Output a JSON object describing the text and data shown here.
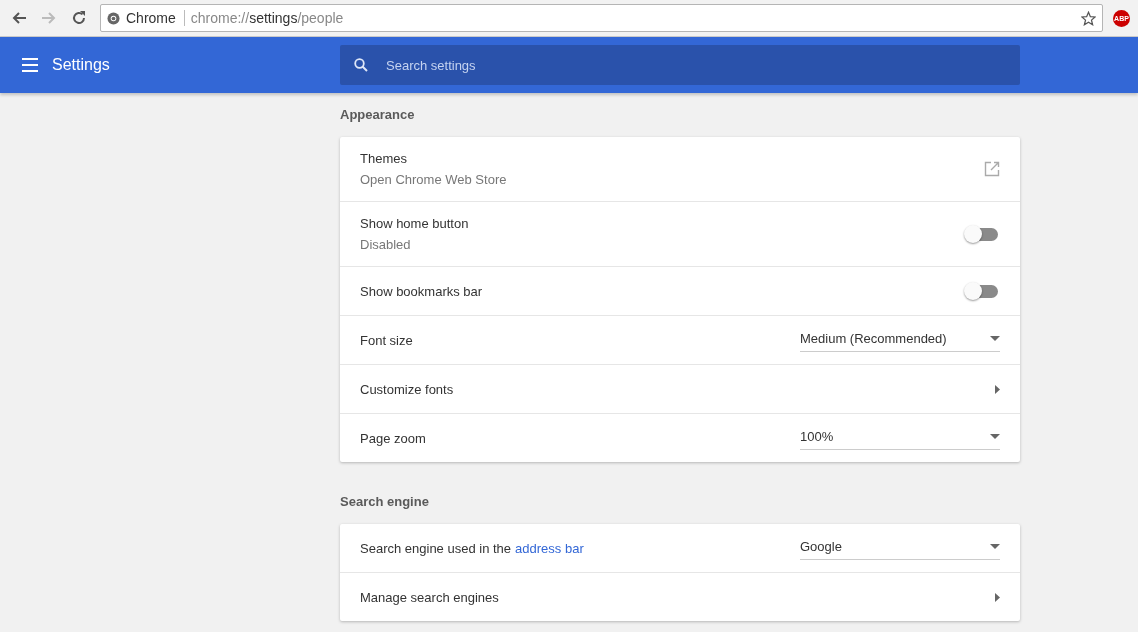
{
  "browser": {
    "site_label": "Chrome",
    "url": {
      "scheme": "chrome://",
      "host": "settings",
      "path": "/people"
    },
    "bookmarked": false,
    "extension_badge": "ABP"
  },
  "header": {
    "title": "Settings",
    "search": {
      "placeholder": "Search settings"
    }
  },
  "sections": [
    {
      "title": "Appearance",
      "rows": [
        {
          "kind": "link",
          "label": "Themes",
          "sublabel": "Open Chrome Web Store"
        },
        {
          "kind": "toggle",
          "label": "Show home button",
          "sublabel": "Disabled",
          "on": false
        },
        {
          "kind": "toggle",
          "label": "Show bookmarks bar",
          "on": false
        },
        {
          "kind": "select",
          "label": "Font size",
          "value": "Medium (Recommended)"
        },
        {
          "kind": "arrow",
          "label": "Customize fonts"
        },
        {
          "kind": "select",
          "label": "Page zoom",
          "value": "100%"
        }
      ]
    },
    {
      "title": "Search engine",
      "rows": [
        {
          "kind": "select",
          "label": "Search engine used in the",
          "link": "address bar",
          "value": "Google"
        },
        {
          "kind": "arrow",
          "label": "Manage search engines"
        }
      ]
    }
  ]
}
